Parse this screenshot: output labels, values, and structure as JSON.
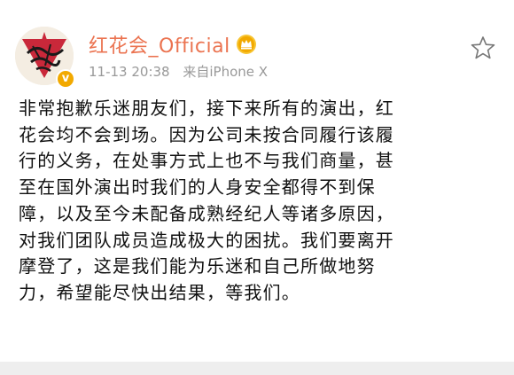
{
  "post": {
    "username": "红花会_Official",
    "time": "11-13 20:38",
    "source": "来自iPhone X",
    "body_lines": [
      "非常抱歉乐迷朋友们，接下来所有的演出，红",
      "花会均不会到场。因为公司未按合同履行该履",
      "行的义务，在处事方式上也不与我们商量，甚",
      "至在国外演出时我们的人身安全都得不到保",
      "障，以及至今未配备成熟经纪人等诸多原因，",
      "对我们团队成员造成极大的困扰。我们要离开",
      "摩登了，这是我们能为乐迷和自己所做地努",
      "力，希望能尽快出结果，等我们。"
    ]
  },
  "icons": {
    "avatar": "avatar-logo",
    "verified": "verified-v-badge",
    "member": "crown-icon",
    "favorite": "star-icon"
  },
  "colors": {
    "username": "#eb7350",
    "meta": "#999999",
    "text": "#111111",
    "badge": "#f2a900",
    "crown": "#f2a900"
  }
}
